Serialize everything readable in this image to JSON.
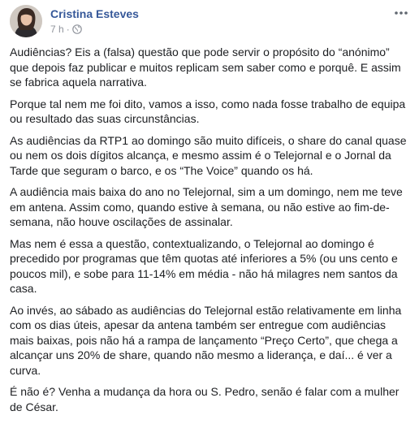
{
  "post": {
    "author": "Cristina Esteves",
    "timestamp": "7 h",
    "separator": "·",
    "privacy_icon": "globe-icon",
    "menu_icon": "more-options-icon",
    "paragraphs": [
      "Audiências? Eis a (falsa) questão que pode servir o propósito do “anónimo” que depois faz publicar e muitos replicam sem saber como e porquê. E assim se fabrica aquela narrativa.",
      "Porque tal nem me foi dito, vamos a isso, como nada fosse trabalho de equipa ou resultado das suas circunstâncias.",
      "As audiências da RTP1 ao domingo são muito difíceis, o share do canal quase ou nem os dois dígitos alcança, e mesmo assim é o Telejornal e o Jornal da Tarde que seguram o barco, e os “The Voice” quando os há.",
      "A audiência mais baixa do ano no Telejornal, sim a um domingo, nem me teve em antena. Assim como, quando estive à semana, ou não estive ao fim-de-semana, não houve oscilações de assinalar.",
      "Mas nem é essa a questão, contextualizando, o Telejornal ao domingo é precedido por programas que têm quotas até inferiores a 5% (ou uns cento e poucos mil), e sobe para 11-14% em média - não há milagres nem santos da casa.",
      "Ao invés, ao sábado as audiências do Telejornal estão relativamente em linha com os dias úteis, apesar da antena também ser entregue com audiências mais baixas, pois não há a rampa de lançamento “Preço Certo”, que chega a alcançar uns 20% de share, quando não mesmo a liderança, e daí... é ver a curva.",
      "É não é? Venha a mudança da hora ou S. Pedro, senão é falar com a mulher de César."
    ]
  }
}
